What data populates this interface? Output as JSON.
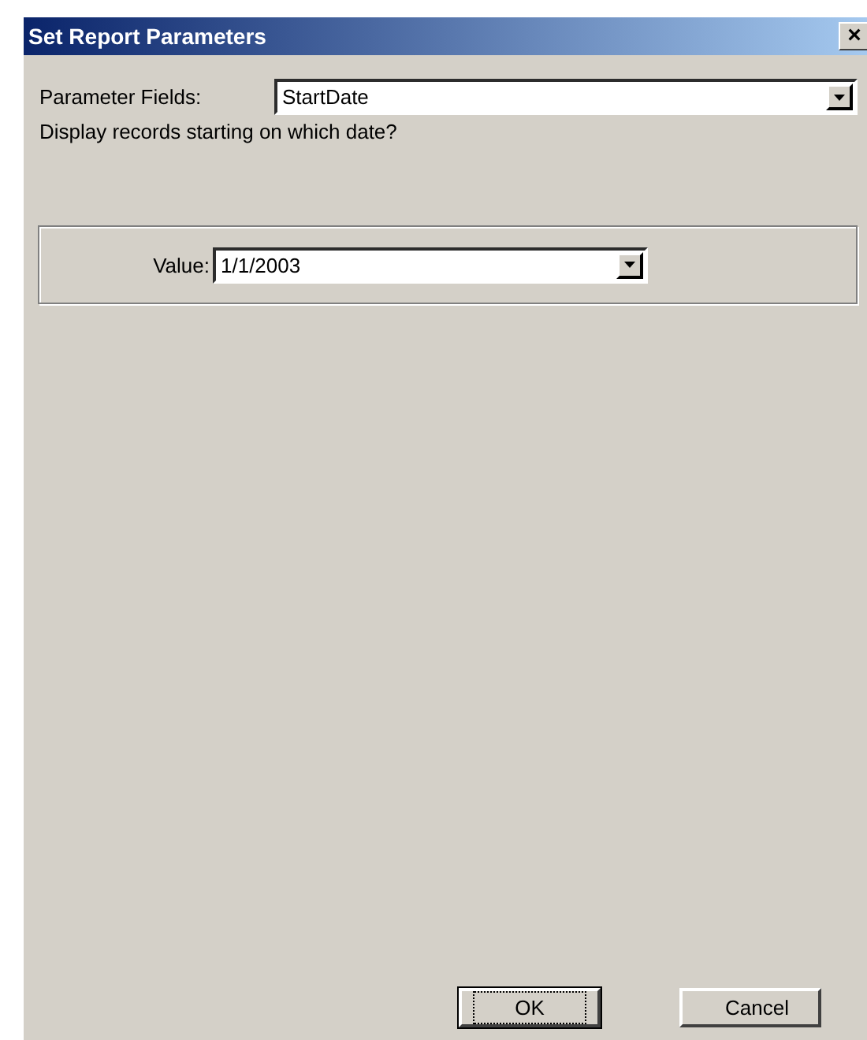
{
  "window": {
    "title": "Set Report Parameters",
    "close": "×"
  },
  "parameter_fields": {
    "label": "Parameter Fields:",
    "value": "StartDate"
  },
  "prompt": "Display records starting on which date?",
  "value_field": {
    "label": "Value:",
    "value": "1/1/2003"
  },
  "buttons": [
    {
      "label": "OK",
      "focused": true
    },
    {
      "label": "Cancel",
      "focused": false
    }
  ]
}
